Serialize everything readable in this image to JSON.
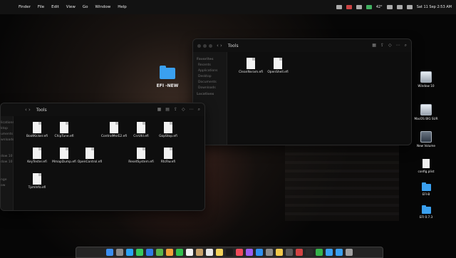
{
  "menubar": {
    "app_menu": "Finder",
    "menus": [
      "File",
      "Edit",
      "View",
      "Go",
      "Window",
      "Help"
    ],
    "status": {
      "temp": "42°",
      "datetime": "Sat 11 Sep  2:53 AM"
    }
  },
  "window_back": {
    "title": "Tools",
    "sidebar": {
      "favorites_header": "Favorites",
      "items": [
        "Recents",
        "Applications",
        "Desktop",
        "Documents",
        "Downloads"
      ],
      "locations_header": "Locations"
    },
    "files": [
      "CleanNvram.efi",
      "OpenShell.efi"
    ]
  },
  "window_front": {
    "title": "Tools",
    "sidebar_partial": [
      "Recents",
      "lications",
      "ktop",
      "uments",
      "wnloads",
      "dow 10",
      "dow 10",
      "nge",
      "ow"
    ],
    "files": [
      "BootKicker.efi",
      "ChipTune.efi",
      "ControlMsrE2.efi",
      "CsrUtil.efi",
      "GopStop.efi",
      "KeyTester.efi",
      "MmapDump.efi",
      "OpenControl.efi",
      "ResetSystem.efi",
      "RtcRw.efi",
      "TpmInfo.efi"
    ]
  },
  "drag_folder": {
    "name": "EFI -NEW"
  },
  "desktop": [
    {
      "name": "Window 10",
      "icon": "hard-drive-icon"
    },
    {
      "name": "MacOS BIG SUR",
      "icon": "hard-drive-icon"
    },
    {
      "name": "New Volume",
      "icon": "hard-drive-icon"
    },
    {
      "name": "config.plist",
      "icon": "document-icon"
    },
    {
      "name": "EFI-B",
      "icon": "folder-icon"
    },
    {
      "name": "EFI 0.7.3",
      "icon": "folder-icon"
    }
  ],
  "dock": {
    "apps": [
      {
        "name": "Finder",
        "color": "#3b8ef0"
      },
      {
        "name": "Launchpad",
        "color": "#8b8b8b"
      },
      {
        "name": "Safari",
        "color": "#2aa3f5"
      },
      {
        "name": "Messages",
        "color": "#38c95c"
      },
      {
        "name": "Mail",
        "color": "#2f7be5"
      },
      {
        "name": "Maps",
        "color": "#59b54c"
      },
      {
        "name": "Photos",
        "color": "#f2a23a"
      },
      {
        "name": "FaceTime",
        "color": "#31c04d"
      },
      {
        "name": "Calendar",
        "color": "#f0f0f0"
      },
      {
        "name": "Contacts",
        "color": "#c9a26a"
      },
      {
        "name": "Reminders",
        "color": "#e6e6e6"
      },
      {
        "name": "Notes",
        "color": "#f3d35b"
      },
      {
        "name": "TV",
        "color": "#1a1a1a"
      },
      {
        "name": "Music",
        "color": "#f04b5b"
      },
      {
        "name": "Podcasts",
        "color": "#9b5df0"
      },
      {
        "name": "App Store",
        "color": "#2f90f0"
      },
      {
        "name": "System Preferences",
        "color": "#8c8c8c"
      },
      {
        "name": "Chrome",
        "color": "#f2c94c"
      },
      {
        "name": "Activity Monitor",
        "color": "#5a5a5a"
      },
      {
        "name": "Xcode",
        "color": "#d24343"
      },
      {
        "name": "Terminal",
        "color": "#2a2a2a"
      },
      {
        "name": "Unknown",
        "color": "#35b34a"
      },
      {
        "name": "Downloads",
        "color": "#3aa0f0"
      },
      {
        "name": "Folder",
        "color": "#3aa0f0"
      },
      {
        "name": "Trash",
        "color": "#a0a0a0"
      }
    ]
  }
}
